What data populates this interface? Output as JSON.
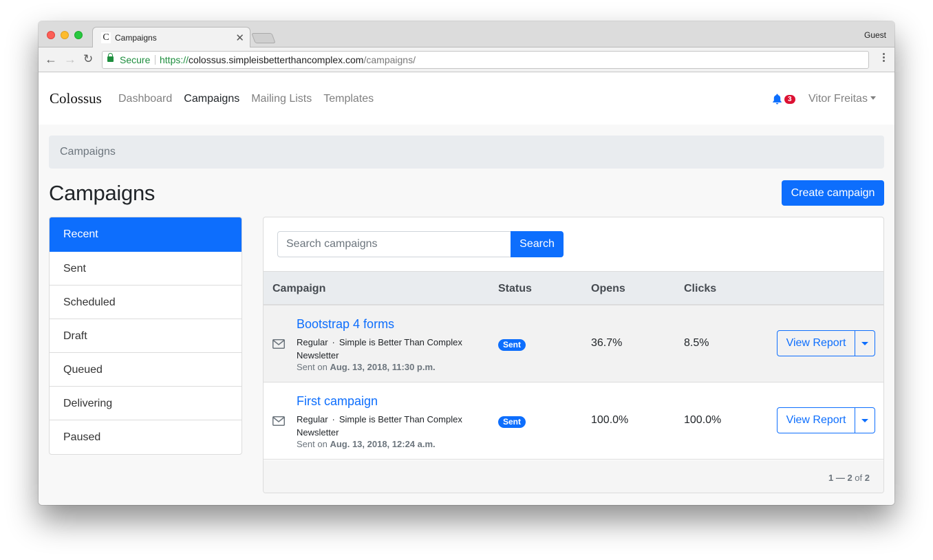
{
  "browser": {
    "tab_title": "Campaigns",
    "tab_favicon": "C",
    "profile": "Guest",
    "secure_label": "Secure",
    "url_scheme": "https://",
    "url_host": "colossus.simpleisbetterthancomplex.com",
    "url_path": "/campaigns/"
  },
  "navbar": {
    "brand": "Colossus",
    "links": [
      {
        "label": "Dashboard",
        "active": false
      },
      {
        "label": "Campaigns",
        "active": true
      },
      {
        "label": "Mailing Lists",
        "active": false
      },
      {
        "label": "Templates",
        "active": false
      }
    ],
    "notification_count": "3",
    "user_name": "Vitor Freitas"
  },
  "breadcrumb": "Campaigns",
  "page_title": "Campaigns",
  "create_button": "Create campaign",
  "sidebar": {
    "items": [
      {
        "label": "Recent",
        "active": true
      },
      {
        "label": "Sent"
      },
      {
        "label": "Scheduled"
      },
      {
        "label": "Draft"
      },
      {
        "label": "Queued"
      },
      {
        "label": "Delivering"
      },
      {
        "label": "Paused"
      }
    ]
  },
  "search": {
    "placeholder": "Search campaigns",
    "value": "",
    "button": "Search"
  },
  "table": {
    "headers": [
      "Campaign",
      "Status",
      "Opens",
      "Clicks"
    ],
    "rows": [
      {
        "name": "Bootstrap 4 forms",
        "type": "Regular",
        "separator": "·",
        "list": "Simple is Better Than Complex Newsletter",
        "sent_prefix": "Sent on",
        "sent_date": "Aug. 13, 2018, 11:30 p.m.",
        "status": "Sent",
        "opens": "36.7%",
        "clicks": "8.5%",
        "action": "View Report"
      },
      {
        "name": "First campaign",
        "type": "Regular",
        "separator": "·",
        "list": "Simple is Better Than Complex Newsletter",
        "sent_prefix": "Sent on",
        "sent_date": "Aug. 13, 2018, 12:24 a.m.",
        "status": "Sent",
        "opens": "100.0%",
        "clicks": "100.0%",
        "action": "View Report"
      }
    ]
  },
  "pagination": {
    "start": "1",
    "dash": "—",
    "end": "2",
    "of_label": "of",
    "total": "2"
  },
  "colors": {
    "primary": "#0d6efd",
    "badge_danger": "#dc1133"
  }
}
